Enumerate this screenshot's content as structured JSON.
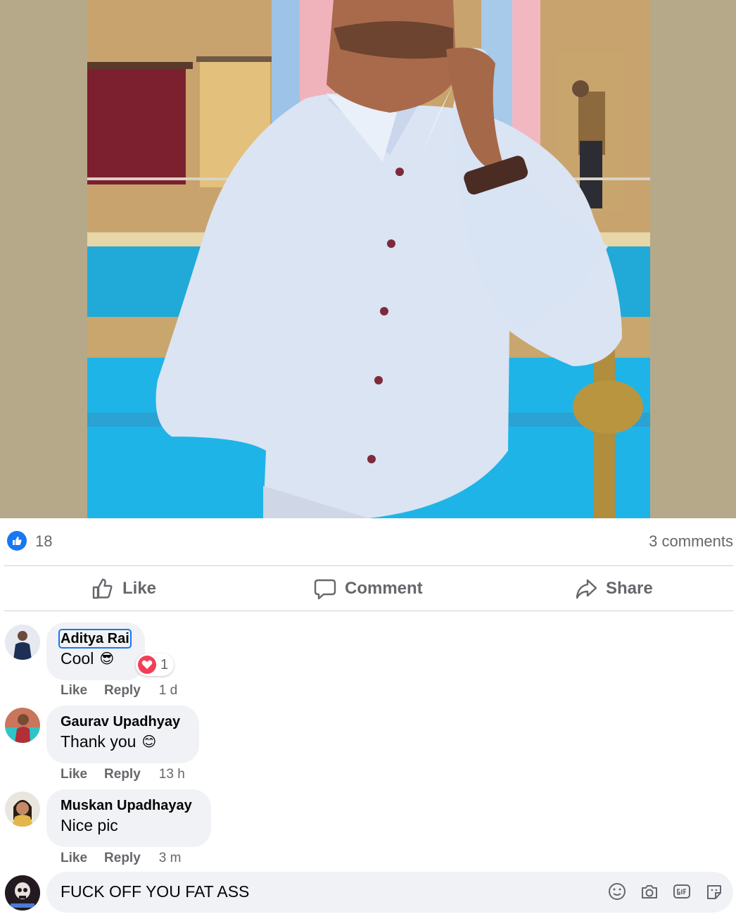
{
  "post": {
    "like_count": "18",
    "comments_count": "3 comments"
  },
  "actions": {
    "like_label": "Like",
    "comment_label": "Comment",
    "share_label": "Share"
  },
  "comments": [
    {
      "author": "Aditya Rai",
      "text": "Cool",
      "emoji": "😎",
      "reaction_count": "1",
      "like_label": "Like",
      "reply_label": "Reply",
      "time": "1 d"
    },
    {
      "author": "Gaurav Upadhyay",
      "text": "Thank you",
      "emoji": "😊",
      "like_label": "Like",
      "reply_label": "Reply",
      "time": "13 h"
    },
    {
      "author": "Muskan Upadhayay",
      "text": "Nice pic",
      "like_label": "Like",
      "reply_label": "Reply",
      "time": "3 m"
    }
  ],
  "composer": {
    "text": "FUCK OFF YOU FAT ASS"
  },
  "colors": {
    "accent": "#1877f2",
    "heart": "#f33e58",
    "secondary_text": "#65676b",
    "bubble": "#f0f2f5"
  }
}
